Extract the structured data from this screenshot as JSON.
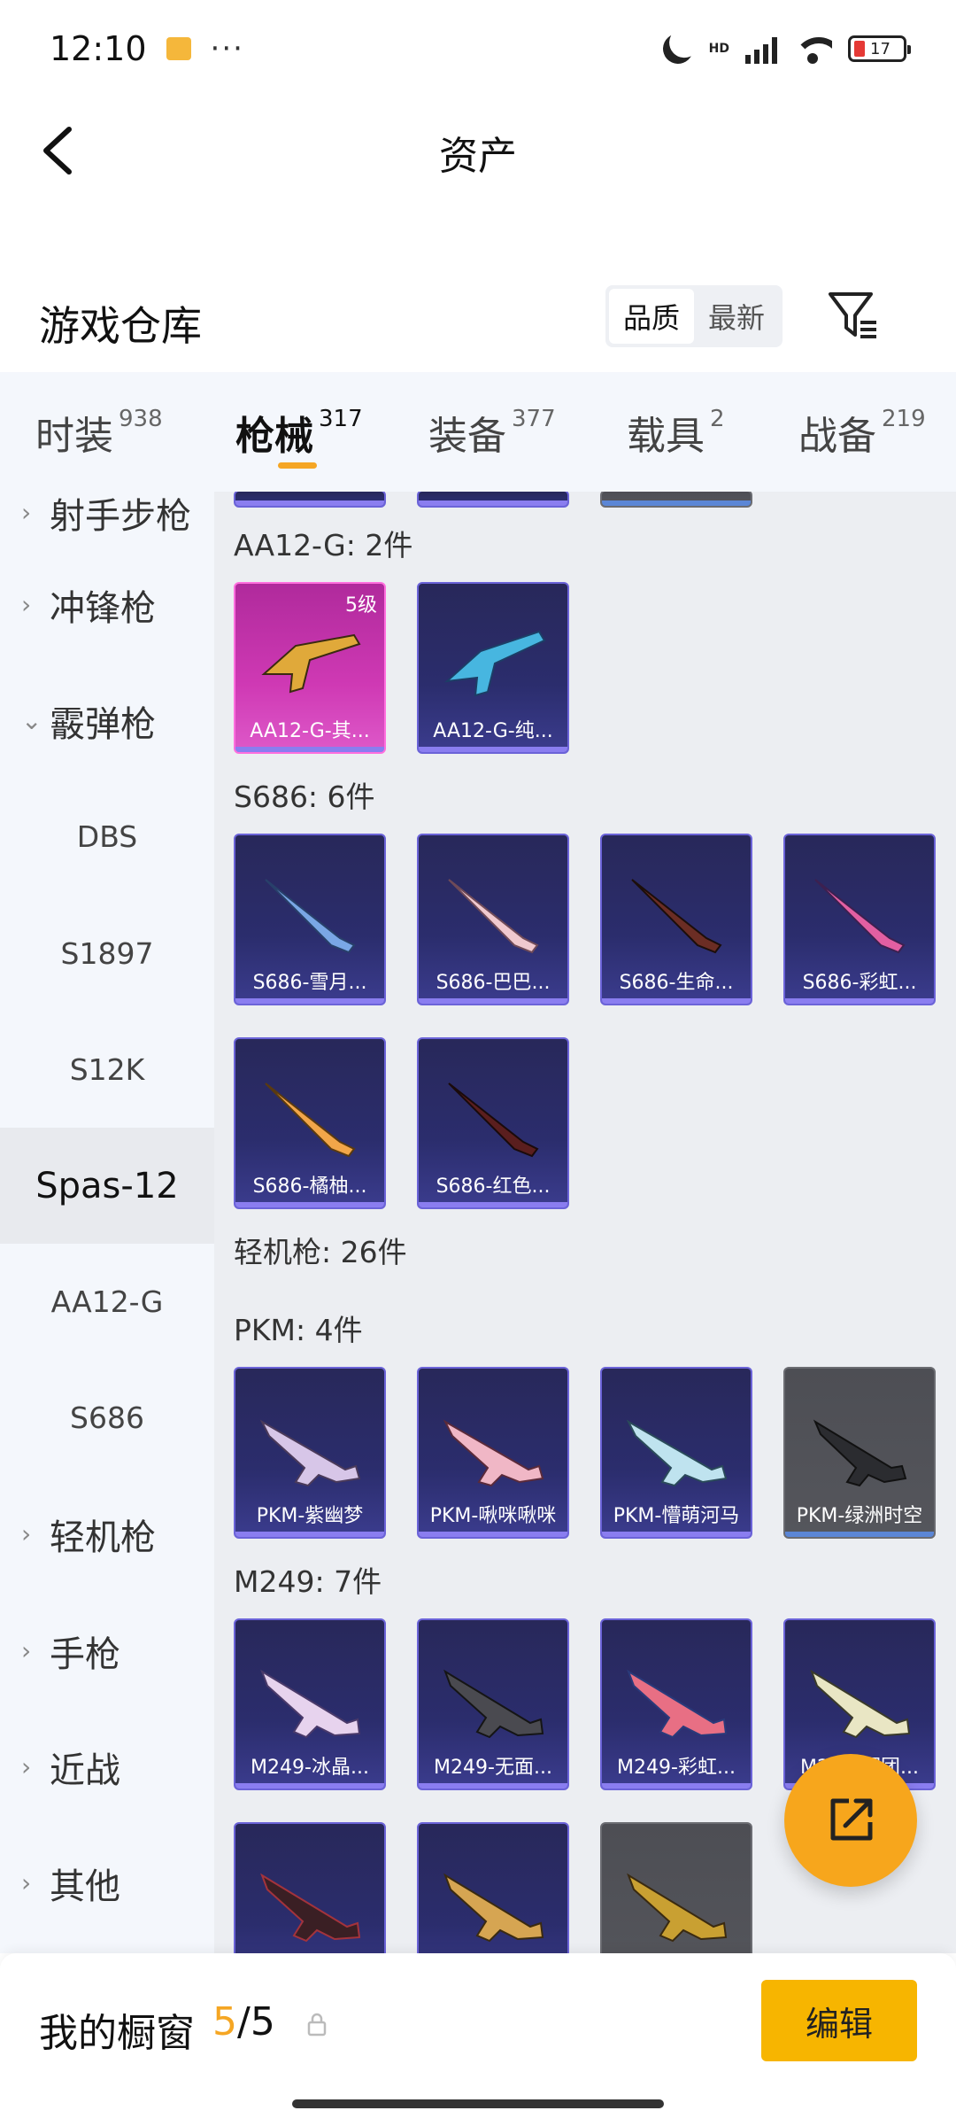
{
  "status_bar": {
    "time": "12:10",
    "battery": "17",
    "network": "HD"
  },
  "header": {
    "title": "资产"
  },
  "warehouse": {
    "title": "游戏仓库",
    "sort_options": [
      "品质",
      "最新"
    ],
    "active_sort": "品质"
  },
  "tabs": [
    {
      "label": "时装",
      "count": "938"
    },
    {
      "label": "枪械",
      "count": "317",
      "active": true
    },
    {
      "label": "装备",
      "count": "377"
    },
    {
      "label": "载具",
      "count": "2"
    },
    {
      "label": "战备",
      "count": "219"
    }
  ],
  "sidebar": {
    "items": [
      {
        "type": "cat",
        "label": "射手步枪",
        "arrow": "›"
      },
      {
        "type": "cat",
        "label": "冲锋枪",
        "arrow": "›"
      },
      {
        "type": "cat",
        "label": "霰弹枪",
        "arrow": "⌄"
      },
      {
        "type": "sub",
        "label": "DBS"
      },
      {
        "type": "sub",
        "label": "S1897"
      },
      {
        "type": "sub",
        "label": "S12K"
      },
      {
        "type": "sub",
        "label": "Spas-12",
        "active": true
      },
      {
        "type": "sub",
        "label": "AA12-G"
      },
      {
        "type": "sub",
        "label": "S686"
      },
      {
        "type": "cat",
        "label": "轻机枪",
        "arrow": "›"
      },
      {
        "type": "cat",
        "label": "手枪",
        "arrow": "›"
      },
      {
        "type": "cat",
        "label": "近战",
        "arrow": "›"
      },
      {
        "type": "cat",
        "label": "其他",
        "arrow": "›"
      }
    ]
  },
  "sections": {
    "aa12": {
      "title": "AA12-G: 2件",
      "cards": [
        {
          "name": "AA12-G-其...",
          "badge": "5级"
        },
        {
          "name": "AA12-G-纯..."
        }
      ]
    },
    "s686": {
      "title": "S686: 6件",
      "cards": [
        {
          "name": "S686-雪月..."
        },
        {
          "name": "S686-巴巴..."
        },
        {
          "name": "S686-生命..."
        },
        {
          "name": "S686-彩虹..."
        },
        {
          "name": "S686-橘柚..."
        },
        {
          "name": "S686-红色..."
        }
      ]
    },
    "lmg": {
      "title": "轻机枪: 26件"
    },
    "pkm": {
      "title": "PKM: 4件",
      "cards": [
        {
          "name": "PKM-紫幽梦"
        },
        {
          "name": "PKM-啾咪啾咪"
        },
        {
          "name": "PKM-懵萌河马"
        },
        {
          "name": "PKM-绿洲时空"
        }
      ]
    },
    "m249": {
      "title": "M249: 7件",
      "cards": [
        {
          "name": "M249-冰晶..."
        },
        {
          "name": "M249-无面..."
        },
        {
          "name": "M249-彩虹..."
        },
        {
          "name": "M249-军团..."
        }
      ]
    }
  },
  "bottom_bar": {
    "title": "我的橱窗",
    "current": "5",
    "total": "/5",
    "edit_label": "编辑"
  },
  "colors": {
    "accent": "#f5a623",
    "card_purple": "#2b2d6d",
    "card_pink": "#cf39b4",
    "card_gray": "#55565c"
  }
}
